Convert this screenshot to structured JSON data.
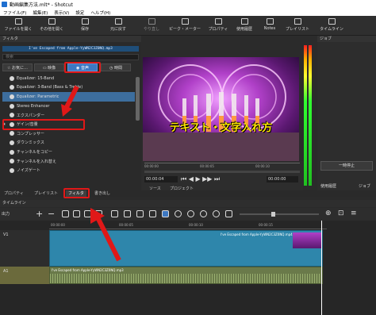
{
  "window": {
    "title": "動画編集方法.mlt* - Shotcut"
  },
  "menu": [
    "ファイル(F)",
    "編集(E)",
    "表示(V)",
    "設定",
    "ヘルプ(H)"
  ],
  "toolbar": [
    {
      "label": "ファイルを開く",
      "icon": "open-file-icon"
    },
    {
      "label": "その他を開く",
      "icon": "open-other-icon"
    },
    {
      "label": "保存",
      "icon": "save-icon"
    },
    {
      "label": "元に戻す",
      "icon": "undo-icon"
    },
    {
      "label": "やり直し",
      "icon": "redo-icon"
    },
    {
      "label": "ピーク・メーター",
      "icon": "peak-meter-icon"
    },
    {
      "label": "プロパティ",
      "icon": "properties-icon"
    },
    {
      "label": "使用履歴",
      "icon": "history-icon"
    },
    {
      "label": "Notes",
      "icon": "notes-icon"
    },
    {
      "label": "プレイリスト",
      "icon": "playlist-icon"
    },
    {
      "label": "タイムライン",
      "icon": "timeline-icon"
    }
  ],
  "filters": {
    "header": "フィルタ",
    "current_clip": "I've Escaped from Apple-YyWN2C3Z0NQ.mp3",
    "search_placeholder": "検索",
    "tabs": [
      {
        "label": "お気に…",
        "selected": false
      },
      {
        "label": "映像",
        "selected": false
      },
      {
        "label": "音声",
        "selected": true
      },
      {
        "label": "時間",
        "selected": false
      }
    ],
    "items": [
      {
        "label": "Equalizer: 15-Band",
        "starred": false,
        "selected": false
      },
      {
        "label": "Equalizer: 3-Band (Bass & Treble)",
        "starred": false,
        "selected": false
      },
      {
        "label": "Equalizer: Parametric",
        "starred": false,
        "selected": true
      },
      {
        "label": "Stereo Enhancer",
        "starred": false,
        "selected": false
      },
      {
        "label": "エクスパンダー",
        "starred": false,
        "selected": false
      },
      {
        "label": "ゲイン/音量",
        "starred": true,
        "selected": false
      },
      {
        "label": "コンプレッサー",
        "starred": false,
        "selected": false
      },
      {
        "label": "ダウンミックス",
        "starred": false,
        "selected": false
      },
      {
        "label": "チャンネルをコピー",
        "starred": false,
        "selected": false
      },
      {
        "label": "チャンネルを入れ替え",
        "starred": false,
        "selected": false
      },
      {
        "label": "ノイズゲート",
        "starred": false,
        "selected": false
      }
    ]
  },
  "player": {
    "overlay_text": "テキスト・文字入れ方",
    "position": "00:00:04",
    "duration": "00:00:00",
    "ruler": [
      "00:00:00",
      "00:00:05",
      "00:00:10"
    ],
    "source_tab": "ソース",
    "project_tab": "プロジェクト"
  },
  "right_pane": {
    "header": "ジョブ",
    "jobs_label": "ジョブ",
    "history_label": "使用履歴",
    "pause_label": "一時停止"
  },
  "meter_scale": [
    "-5",
    "-10",
    "-15",
    "-20",
    "-25",
    "-30",
    "-35",
    "-40",
    "-45",
    "-50"
  ],
  "bottom_tabs": [
    {
      "label": "プロパティ",
      "selected": false
    },
    {
      "label": "プレイリスト",
      "selected": false
    },
    {
      "label": "フィルタ",
      "selected": true
    },
    {
      "label": "書き出し",
      "selected": false
    }
  ],
  "timeline": {
    "header": "タイムライン",
    "output_label": "出力",
    "ruler": [
      "00:00:00",
      "00:00:05",
      "00:00:10",
      "00:00:15"
    ],
    "tracks": [
      {
        "name": "V1",
        "clip": "I've Escaped from Apple-YyWN2C3Z0NQ.mp4"
      },
      {
        "name": "A1",
        "clip": "I've Escaped from Apple-YyWN2C3Z0NQ.mp3"
      }
    ]
  },
  "colors": {
    "accent": "#3d78c2",
    "highlight": "#e01818",
    "video_track": "#2e86ab",
    "audio_track": "#6b6a3c"
  }
}
